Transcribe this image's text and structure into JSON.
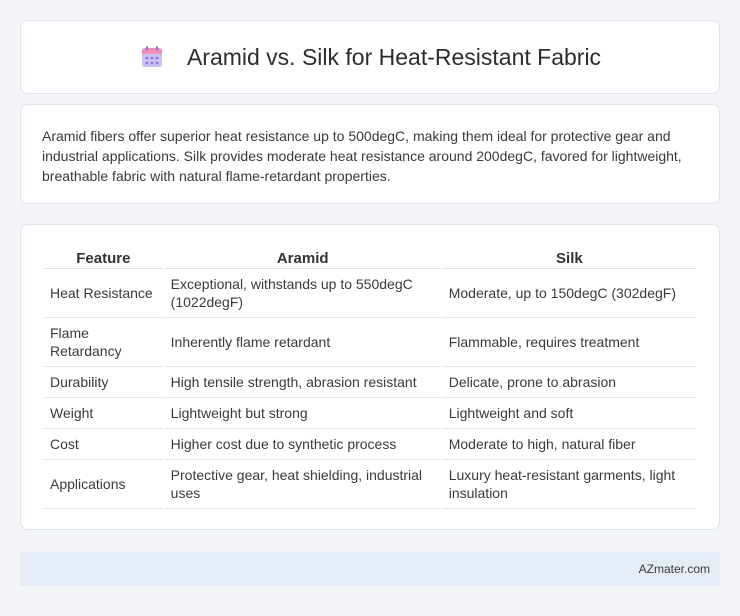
{
  "header": {
    "title": "Aramid vs. Silk for Heat-Resistant Fabric",
    "icon": "calendar-icon"
  },
  "intro": {
    "text": "Aramid fibers offer superior heat resistance up to 500degC, making them ideal for protective gear and industrial applications. Silk provides moderate heat resistance around 200degC, favored for lightweight, breathable fabric with natural flame-retardant properties."
  },
  "table": {
    "headers": [
      "Feature",
      "Aramid",
      "Silk"
    ],
    "rows": [
      [
        "Heat Resistance",
        "Exceptional, withstands up to 550degC (1022degF)",
        "Moderate, up to 150degC (302degF)"
      ],
      [
        "Flame Retardancy",
        "Inherently flame retardant",
        "Flammable, requires treatment"
      ],
      [
        "Durability",
        "High tensile strength, abrasion resistant",
        "Delicate, prone to abrasion"
      ],
      [
        "Weight",
        "Lightweight but strong",
        "Lightweight and soft"
      ],
      [
        "Cost",
        "Higher cost due to synthetic process",
        "Moderate to high, natural fiber"
      ],
      [
        "Applications",
        "Protective gear, heat shielding, industrial uses",
        "Luxury heat-resistant garments, light insulation"
      ]
    ]
  },
  "footer": {
    "text": "AZmater.com"
  },
  "colors": {
    "icon_top": "#f08fb4",
    "icon_body": "#b7a6f0",
    "icon_dots": "#8a74e0"
  }
}
